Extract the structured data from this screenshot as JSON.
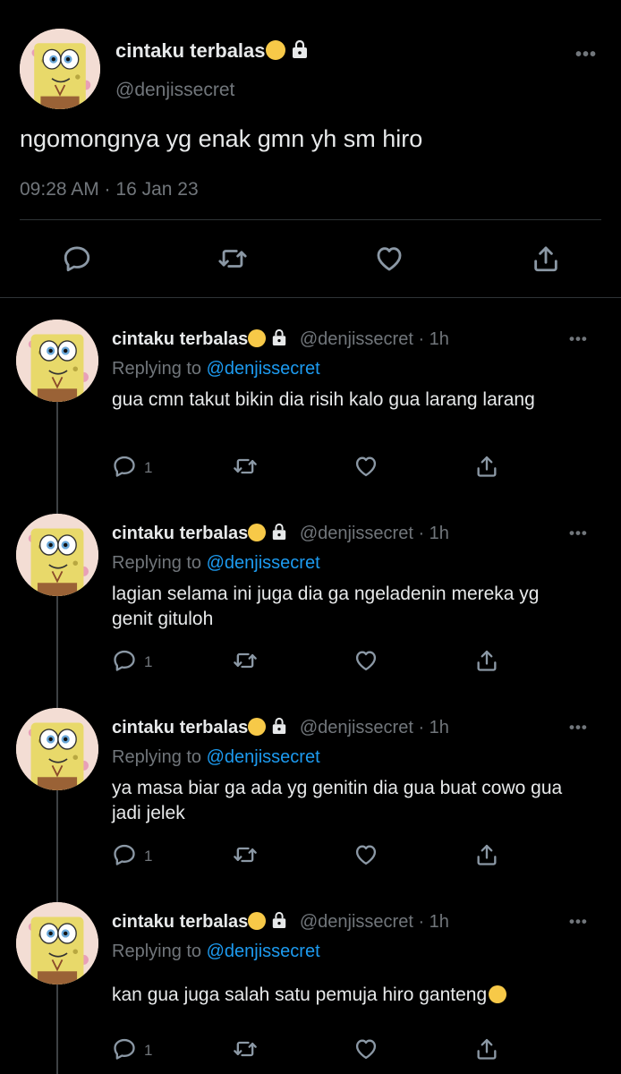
{
  "main": {
    "author_name": "cintaku terbalas",
    "author_emoji": "face-exhaling-emoji",
    "handle": "@denjissecret",
    "text": "ngomongnya yg enak gmn yh sm hiro",
    "timestamp": "09:28 AM · 16 Jan 23",
    "more_label": "•••"
  },
  "replies": [
    {
      "name": "cintaku terbalas",
      "meta": "@denjissecret · 1h",
      "replying_prefix": "Replying to",
      "replying_handle": "@denjissecret",
      "text": "gua cmn takut bikin dia risih kalo gua larang larang",
      "reply_count": "1"
    },
    {
      "name": "cintaku terbalas",
      "meta": "@denjissecret · 1h",
      "replying_prefix": "Replying to",
      "replying_handle": "@denjissecret",
      "text": "lagian selama ini juga dia ga ngeladenin mereka yg genit gituloh",
      "reply_count": "1"
    },
    {
      "name": "cintaku terbalas",
      "meta": "@denjissecret · 1h",
      "replying_prefix": "Replying to",
      "replying_handle": "@denjissecret",
      "text": "ya masa biar ga ada yg genitin dia gua buat cowo gua jadi jelek",
      "reply_count": "1"
    },
    {
      "name": "cintaku terbalas",
      "meta": "@denjissecret · 1h",
      "replying_prefix": "Replying to",
      "replying_handle": "@denjissecret",
      "text": "kan gua juga salah satu pemuja hiro ganteng",
      "text_emoji": "pensive-face-emoji",
      "reply_count": "1"
    }
  ],
  "more_label": "•••"
}
